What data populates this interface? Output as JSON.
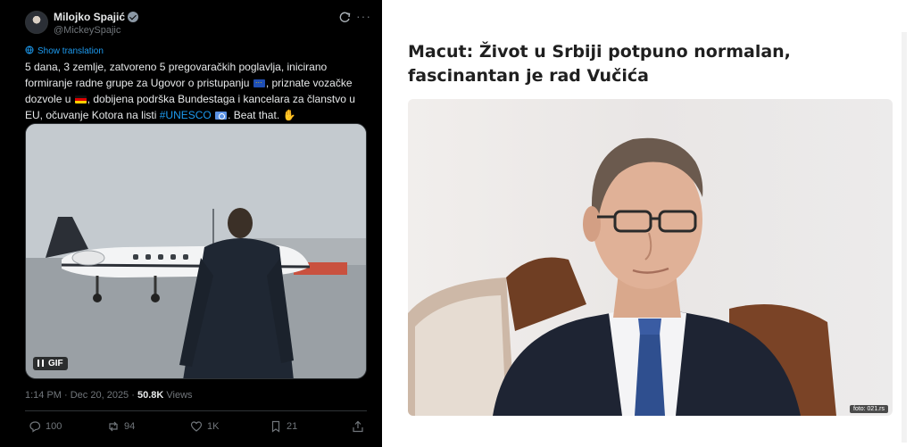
{
  "tweet": {
    "author_name": "Milojko Spajić",
    "author_handle": "@MickeySpajic",
    "show_translation": "Show translation",
    "text": {
      "part1": "5 dana, 3 zemlje, zatvoreno 5 pregovaračkih poglavlja, inicirano formiranje radne grupe za Ugovor o pristupanju ",
      "part2": ", priznate vozačke dozvole u ",
      "part3": ", dobijena podrška Bundestaga i kancelara za članstvo u EU, očuvanje Kotora na listi ",
      "hashtag": "#UNESCO",
      "part4": ". Beat that. "
    },
    "gif_label": "GIF",
    "time": "1:14 PM · Dec 20, 2025",
    "separator": "·",
    "views_count": "50.8K",
    "views_label": "Views",
    "replies": "100",
    "reposts": "94",
    "likes": "1K",
    "bookmarks": "21"
  },
  "article": {
    "headline": "Macut: Život u Srbiji potpuno normalan, fascinantan je rad Vučića",
    "photo_credit": "foto: 021.rs"
  },
  "colors": {
    "tweet_bg": "#000000",
    "link_blue": "#1d9bf0",
    "muted": "#71767b",
    "headline": "#1f1f1f"
  },
  "icons": [
    "verified-icon",
    "grok-icon",
    "more-icon",
    "globe-icon",
    "eu-flag-icon",
    "germany-flag-icon",
    "un-flag-icon",
    "waving-hand-icon",
    "pause-icon",
    "reply-icon",
    "repost-icon",
    "like-icon",
    "bookmark-icon",
    "share-icon"
  ]
}
